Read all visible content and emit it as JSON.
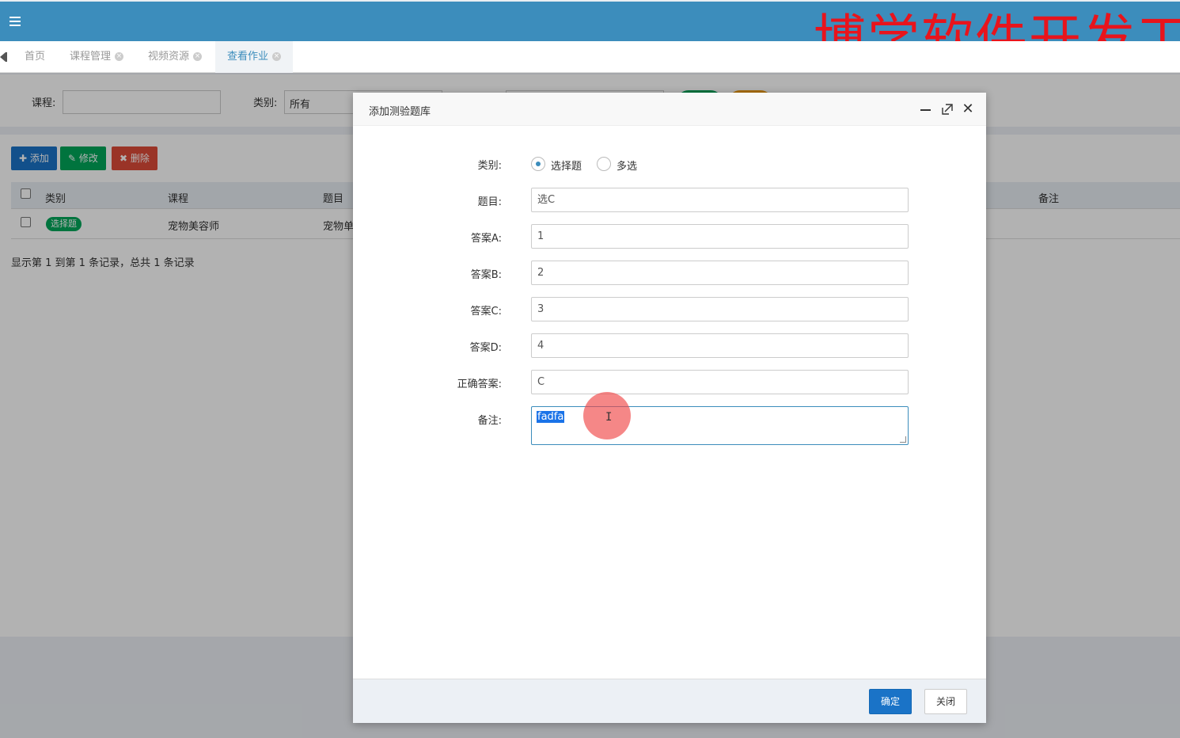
{
  "watermark": "博学软件开发工",
  "tabs": [
    {
      "label": "首页"
    },
    {
      "label": "课程管理"
    },
    {
      "label": "视频资源"
    },
    {
      "label": "查看作业"
    }
  ],
  "search": {
    "course_label": "课程:",
    "category_label": "类别:",
    "category_value": "所有"
  },
  "toolbar": {
    "add": "✚ 添加",
    "edit": "✎ 修改",
    "delete": "✖ 删除"
  },
  "table": {
    "columns": [
      "类别",
      "课程",
      "题目",
      "备注"
    ],
    "rows": [
      {
        "category": "选择题",
        "course": "宠物美容师",
        "question": "宠物单"
      }
    ]
  },
  "pager_text": "显示第 1 到第 1 条记录，总共 1 条记录",
  "modal": {
    "title": "添加测验题库",
    "category_label": "类别:",
    "option_single": "选择题",
    "option_multi": "多选",
    "question_label": "题目:",
    "question_value": "选C",
    "a_label": "答案A:",
    "a_value": "1",
    "b_label": "答案B:",
    "b_value": "2",
    "c_label": "答案C:",
    "c_value": "3",
    "d_label": "答案D:",
    "d_value": "4",
    "correct_label": "正确答案:",
    "correct_value": "C",
    "remark_label": "备注:",
    "remark_value": "fadfa",
    "ok_button": "确定",
    "close_button": "关闭"
  },
  "colors": {
    "header": "#3c8dbc",
    "primary": "#1a73c7",
    "success": "#00a65a",
    "danger": "#dd4b39",
    "watermark": "#e8141c"
  }
}
